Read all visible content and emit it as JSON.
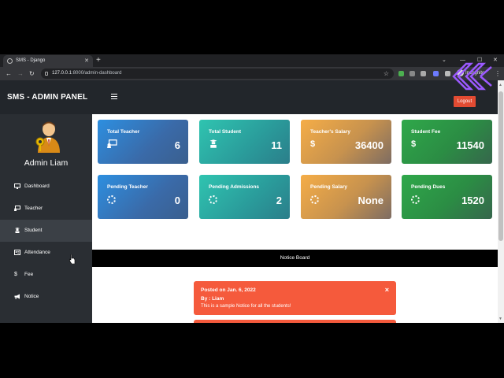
{
  "browser": {
    "tab_title": "SMS - Django",
    "url_host": "127.0.0.1",
    "url_rest": ":8000/admin-dashboard",
    "incognito_label": "Incognito"
  },
  "header": {
    "brand": "SMS - ADMIN PANEL",
    "logout_label": "Logout"
  },
  "sidebar": {
    "admin_name": "Admin Liam",
    "items": [
      {
        "label": "Dashboard",
        "icon": "monitor-icon"
      },
      {
        "label": "Teacher",
        "icon": "chalkboard-icon"
      },
      {
        "label": "Student",
        "icon": "student-icon"
      },
      {
        "label": "Attendance",
        "icon": "id-card-icon"
      },
      {
        "label": "Fee",
        "icon": "dollar-icon"
      },
      {
        "label": "Notice",
        "icon": "megaphone-icon"
      }
    ]
  },
  "cards": [
    {
      "label": "Total Teacher",
      "value": "6",
      "icon": "chalkboard-icon",
      "color": "#2d8fe0"
    },
    {
      "label": "Total Student",
      "value": "11",
      "icon": "student-icon",
      "color": "#2fc4b0"
    },
    {
      "label": "Teacher's Salary",
      "value": "36400",
      "icon": "dollar-icon",
      "color": "#f5ad47"
    },
    {
      "label": "Student Fee",
      "value": "11540",
      "icon": "dollar-icon",
      "color": "#2fa84a"
    },
    {
      "label": "Pending Teacher",
      "value": "0",
      "icon": "spinner-icon",
      "color": "#2d8fe0"
    },
    {
      "label": "Pending Admissions",
      "value": "2",
      "icon": "spinner-icon",
      "color": "#2fc4b0"
    },
    {
      "label": "Pending Salary",
      "value": "None",
      "icon": "spinner-icon",
      "color": "#f5ad47"
    },
    {
      "label": "Pending Dues",
      "value": "1520",
      "icon": "spinner-icon",
      "color": "#2fa84a"
    }
  ],
  "notice_board": {
    "title": "Notice Board",
    "notices": [
      {
        "posted": "Posted on Jan. 6, 2022",
        "by": "By : Liam",
        "message": "This is a sample Notice for all the students!",
        "close": "×"
      }
    ]
  }
}
